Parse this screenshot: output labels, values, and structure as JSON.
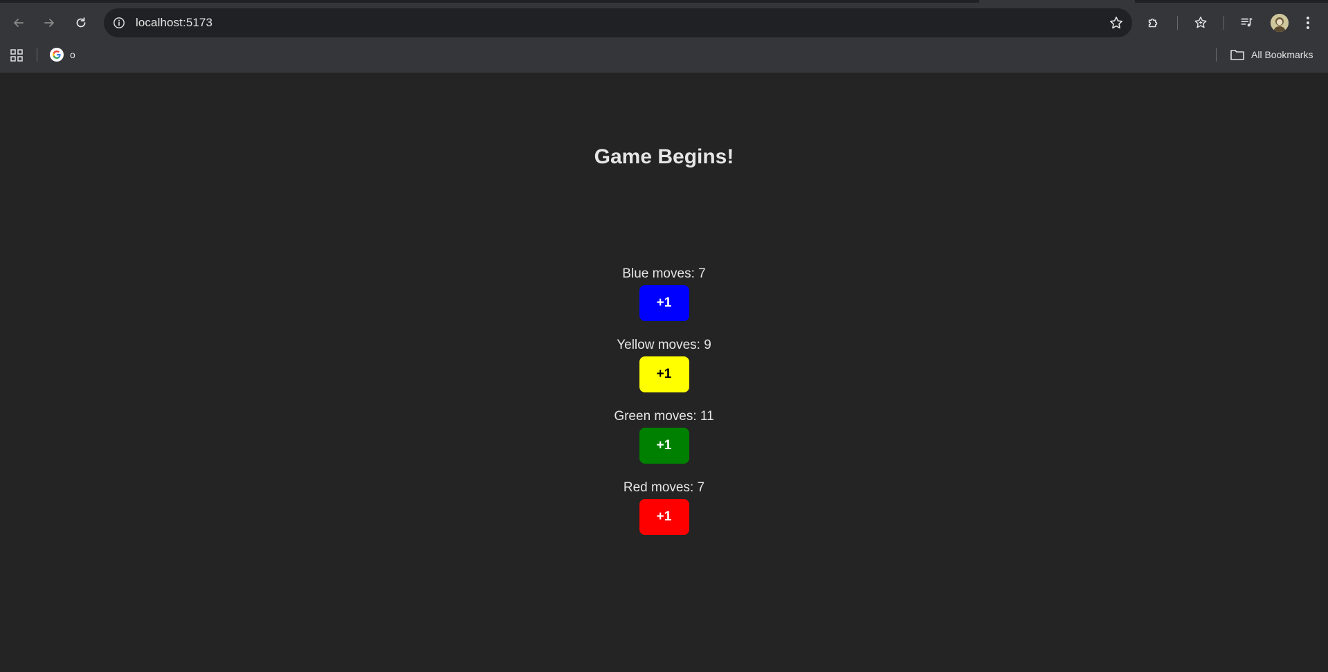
{
  "browser": {
    "url": "localhost:5173",
    "bookmarks": [
      {
        "label": "o"
      }
    ],
    "all_bookmarks_label": "All Bookmarks"
  },
  "game": {
    "title": "Game Begins!",
    "players": [
      {
        "label": "Blue moves: 7",
        "button_label": "+1",
        "color": "#0000ff",
        "text_color": "#ffffff"
      },
      {
        "label": "Yellow moves: 9",
        "button_label": "+1",
        "color": "#ffff00",
        "text_color": "#000000"
      },
      {
        "label": "Green moves: 11",
        "button_label": "+1",
        "color": "#008000",
        "text_color": "#ffffff"
      },
      {
        "label": "Red moves: 7",
        "button_label": "+1",
        "color": "#ff0000",
        "text_color": "#ffffff"
      }
    ]
  },
  "theme": {
    "page_background": "#242424",
    "chrome_background": "#35363a",
    "omnibox_background": "#202124"
  }
}
